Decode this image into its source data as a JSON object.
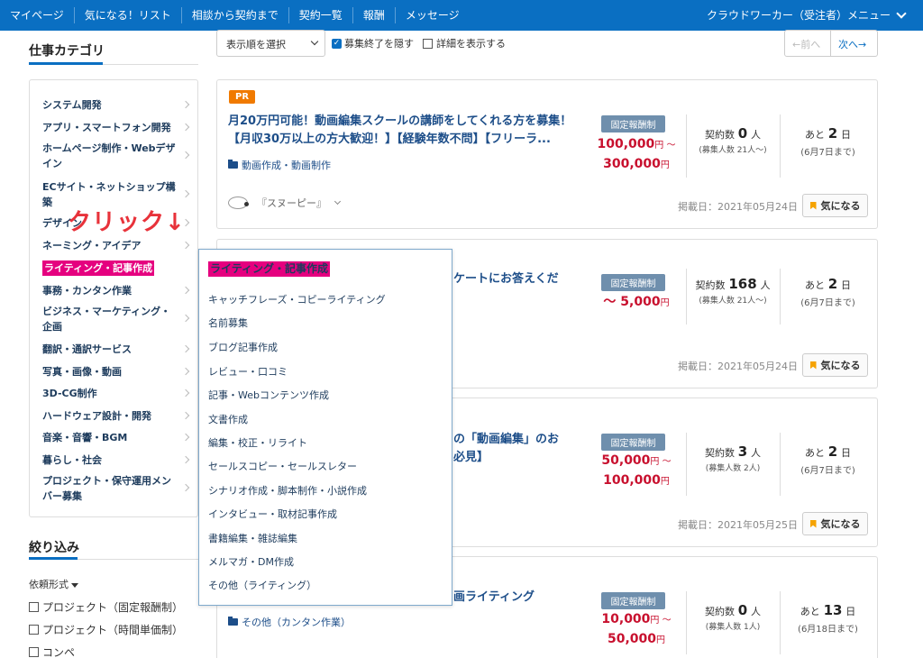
{
  "topnav": {
    "items": [
      "マイページ",
      "気になる！リスト",
      "相談から契約まで",
      "契約一覧",
      "報酬",
      "メッセージ"
    ],
    "right_menu": "クラウドワーカー（受注者）メニュー"
  },
  "sidebar": {
    "title": "仕事カテゴリ",
    "categories": [
      "システム開発",
      "アプリ・スマートフォン開発",
      "ホームページ制作・Webデザイン",
      "ECサイト・ネットショップ構築",
      "デザイン",
      "ネーミング・アイデア",
      "ライティング・記事作成",
      "事務・カンタン作業",
      "ビジネス・マーケティング・企画",
      "翻訳・通訳サービス",
      "写真・画像・動画",
      "3D-CG制作",
      "ハードウェア設計・開発",
      "音楽・音響・BGM",
      "暮らし・社会",
      "プロジェクト・保守運用メンバー募集"
    ],
    "annotation": "クリック↓",
    "filter_title": "絞り込み",
    "filter_type_label": "依頼形式",
    "filter_options": [
      "プロジェクト（固定報酬制）",
      "プロジェクト（時間単価制）",
      "コンペ"
    ]
  },
  "toolbar": {
    "sort_placeholder": "表示順を選択",
    "hide_closed": "募集終了を隠す",
    "show_details": "詳細を表示する",
    "prev": "←前へ",
    "next": "次へ→"
  },
  "flyout": {
    "title": "ライティング・記事作成",
    "items": [
      "キャッチフレーズ・コピーライティング",
      "名前募集",
      "ブログ記事作成",
      "レビュー・口コミ",
      "記事・Webコンテンツ作成",
      "文書作成",
      "編集・校正・リライト",
      "セールスコピー・セールスレター",
      "シナリオ作成・脚本制作・小説作成",
      "インタビュー・取材記事作成",
      "書籍編集・雑誌編集",
      "メルマガ・DM作成",
      "その他（ライティング）"
    ]
  },
  "jobs": [
    {
      "pr": "PR",
      "title_line1": "月20万円可能！動画編集スクールの講師をしてくれる方を募集！",
      "title_line2": "【月収30万以上の方大歓迎！】【経験年数不問】【フリーラ...",
      "category": "動画作成・動画制作",
      "badge": "固定報酬制",
      "price_line1": "100,000",
      "price_line1_unit": "円 ～",
      "price_line2": "300,000",
      "price_line2_unit": "円",
      "contracts_label": "契約数",
      "contracts_num": "0",
      "contracts_unit": "人",
      "applicants": "(募集人数 21人～)",
      "remain_label": "あと",
      "remain_num": "2",
      "remain_unit": "日",
      "deadline": "(6月7日まで)",
      "client": "『スヌーピー』",
      "posted": "掲載日：2021年05月24日",
      "fav": "気になる"
    },
    {
      "title_line1": "ケートにお答えくだ",
      "badge": "固定報酬制",
      "price_line1": "～ 5,000",
      "price_line1_unit": "円",
      "contracts_label": "契約数",
      "contracts_num": "168",
      "contracts_unit": "人",
      "applicants": "(募集人数 21人～)",
      "remain_label": "あと",
      "remain_num": "2",
      "remain_unit": "日",
      "deadline": "(6月7日まで)",
      "posted": "掲載日：2021年05月24日",
      "fav": "気になる"
    },
    {
      "title_line1": "の「動画編集」のお",
      "title_line2": "必見】",
      "badge": "固定報酬制",
      "price_line1": "50,000",
      "price_line1_unit": "円 ～",
      "price_line2": "100,000",
      "price_line2_unit": "円",
      "contracts_label": "契約数",
      "contracts_num": "3",
      "contracts_unit": "人",
      "applicants": "(募集人数 2人)",
      "remain_label": "あと",
      "remain_num": "2",
      "remain_unit": "日",
      "deadline": "(6月7日まで)",
      "posted": "掲載日：2021年05月25日",
      "fav": "気になる"
    },
    {
      "title_line1": "画ライティング",
      "category": "その他（カンタン作業）",
      "badge": "固定報酬制",
      "price_line1": "10,000",
      "price_line1_unit": "円 ～",
      "price_line2": "50,000",
      "price_line2_unit": "円",
      "contracts_label": "契約数",
      "contracts_num": "0",
      "contracts_unit": "人",
      "applicants": "(募集人数 1人)",
      "remain_label": "あと",
      "remain_num": "13",
      "remain_unit": "日",
      "deadline": "(6月18日まで)"
    }
  ]
}
